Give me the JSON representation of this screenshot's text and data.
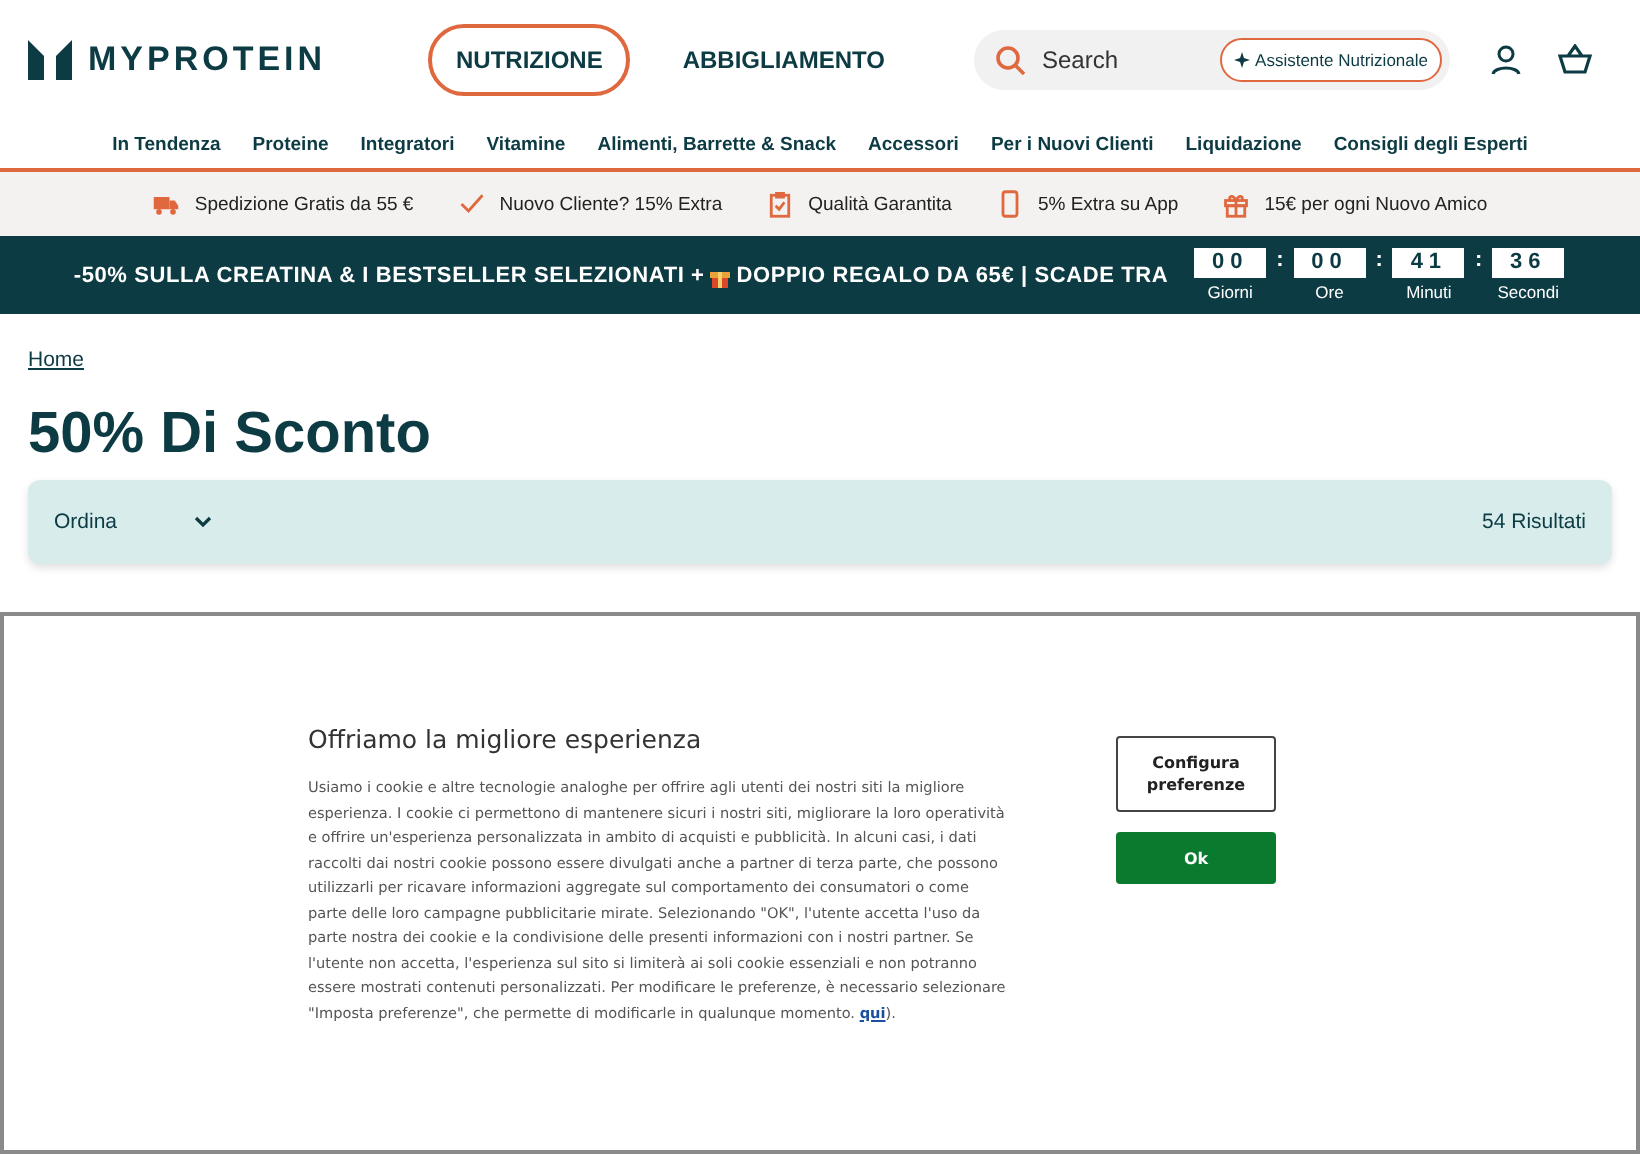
{
  "header": {
    "logo": "MYPROTEIN",
    "main_tabs": [
      {
        "label": "NUTRIZIONE",
        "selected": true
      },
      {
        "label": "ABBIGLIAMENTO",
        "selected": false
      }
    ],
    "search": {
      "placeholder": "Search"
    },
    "assistant_button": "Assistente Nutrizionale"
  },
  "nav": [
    "In Tendenza",
    "Proteine",
    "Integratori",
    "Vitamine",
    "Alimenti, Barrette & Snack",
    "Accessori",
    "Per i Nuovi Clienti",
    "Liquidazione",
    "Consigli degli Esperti"
  ],
  "perks": [
    {
      "kind": "truck",
      "label": "Spedizione Gratis da 55 €"
    },
    {
      "kind": "check",
      "label": "Nuovo Cliente? 15% Extra"
    },
    {
      "kind": "clipboard",
      "label": "Qualità Garantita"
    },
    {
      "kind": "phone",
      "label": "5% Extra su App"
    },
    {
      "kind": "gift",
      "label": "15€ per ogni Nuovo Amico"
    }
  ],
  "promo": {
    "before": "-50% SULLA CREATINA & I BESTSELLER SELEZIONATI + ",
    "after": " DOPPIO REGALO DA 65€ | SCADE TRA",
    "separator": ":",
    "countdown": [
      {
        "value": "00",
        "unit": "Giorni"
      },
      {
        "value": "00",
        "unit": "Ore"
      },
      {
        "value": "41",
        "unit": "Minuti"
      },
      {
        "value": "36",
        "unit": "Secondi"
      }
    ]
  },
  "breadcrumb": "Home",
  "title": "50% Di Sconto",
  "sort": {
    "label": "Ordina",
    "results": "54 Risultati"
  },
  "cookie": {
    "title": "Offriamo la migliore esperienza",
    "text": "Usiamo i cookie e altre tecnologie analoghe per offrire agli utenti dei nostri siti la migliore esperienza. I cookie ci permettono di mantenere sicuri i nostri siti, migliorare la loro operatività e offrire un'esperienza personalizzata in ambito di acquisti e pubblicità. In alcuni casi, i dati raccolti dai nostri cookie possono essere divulgati anche a partner di terza parte, che possono utilizzarli per ricavare informazioni aggregate sul comportamento dei consumatori o come parte delle loro campagne pubblicitarie mirate. Selezionando \"OK\", l'utente accetta l'uso da parte nostra dei cookie e la condivisione delle presenti informazioni con i nostri partner. Se l'utente non accetta, l'esperienza sul sito si limiterà ai soli cookie essenziali e non potranno essere mostrati contenuti personalizzati. Per modificare le preferenze, è necessario selezionare \"Imposta preferenze\", che permette di modificarle in qualunque momento. ",
    "link": "qui",
    "text_after": ").",
    "buttons": [
      {
        "kind": "outline",
        "label": "Configura preferenze"
      },
      {
        "kind": "primary",
        "label": "Ok"
      }
    ]
  }
}
